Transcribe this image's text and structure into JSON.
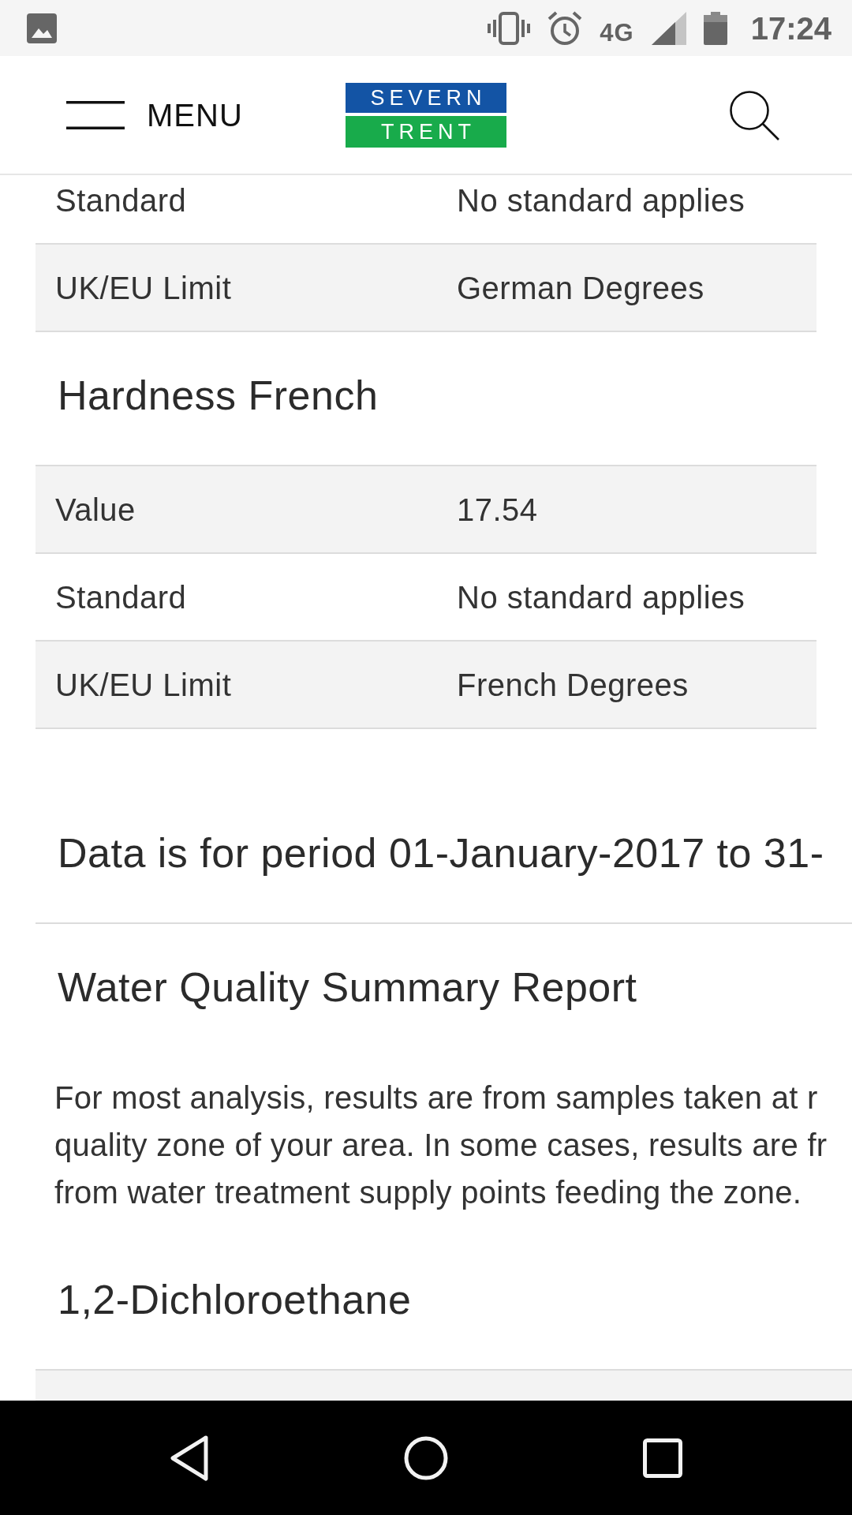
{
  "status_bar": {
    "network": "4G",
    "time": "17:24"
  },
  "header": {
    "menu_label": "MENU",
    "logo": {
      "top": "SEVERN",
      "bottom": "TRENT"
    }
  },
  "sections": [
    {
      "kind": "table",
      "rows": [
        {
          "label": "Standard",
          "value": "No standard applies",
          "shaded": false
        },
        {
          "label": "UK/EU Limit",
          "value": "German Degrees",
          "shaded": true
        }
      ]
    },
    {
      "kind": "heading",
      "text": "Hardness French"
    },
    {
      "kind": "table",
      "rows": [
        {
          "label": "Value",
          "value": "17.54",
          "shaded": true
        },
        {
          "label": "Standard",
          "value": "No standard applies",
          "shaded": false
        },
        {
          "label": "UK/EU Limit",
          "value": "French Degrees",
          "shaded": true
        }
      ]
    },
    {
      "kind": "period",
      "text": "Data is for period 01-January-2017 to 31-"
    },
    {
      "kind": "heading",
      "text": "Water Quality Summary Report"
    },
    {
      "kind": "paragraph",
      "lines": [
        "For most analysis, results are from samples taken at r",
        "quality zone of your area. In some cases, results are fr",
        "from water treatment supply points feeding the zone."
      ]
    },
    {
      "kind": "heading",
      "text": "1,2-Dichloroethane"
    },
    {
      "kind": "table",
      "rows": [
        {
          "shaded": true
        }
      ]
    }
  ]
}
